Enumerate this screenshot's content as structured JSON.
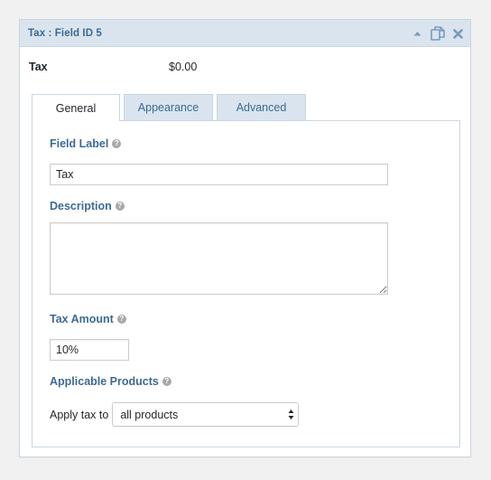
{
  "panel": {
    "title": "Tax : Field ID 5",
    "icons": [
      "collapse-icon",
      "duplicate-icon",
      "close-icon"
    ],
    "colors": {
      "header_bg": "#d9e4ee",
      "accent": "#3d6a94",
      "border": "#c9d6e2"
    }
  },
  "preview": {
    "label": "Tax",
    "value": "$0.00"
  },
  "tabs": [
    {
      "label": "General",
      "active": true
    },
    {
      "label": "Appearance",
      "active": false
    },
    {
      "label": "Advanced",
      "active": false
    }
  ],
  "general": {
    "field_label": {
      "label": "Field Label",
      "value": "Tax"
    },
    "description": {
      "label": "Description",
      "value": ""
    },
    "tax_amount": {
      "label": "Tax Amount",
      "value": "10%"
    },
    "applicable_products": {
      "label": "Applicable Products",
      "apply_text": "Apply tax to",
      "selected": "all products"
    },
    "help_glyph": "?"
  }
}
